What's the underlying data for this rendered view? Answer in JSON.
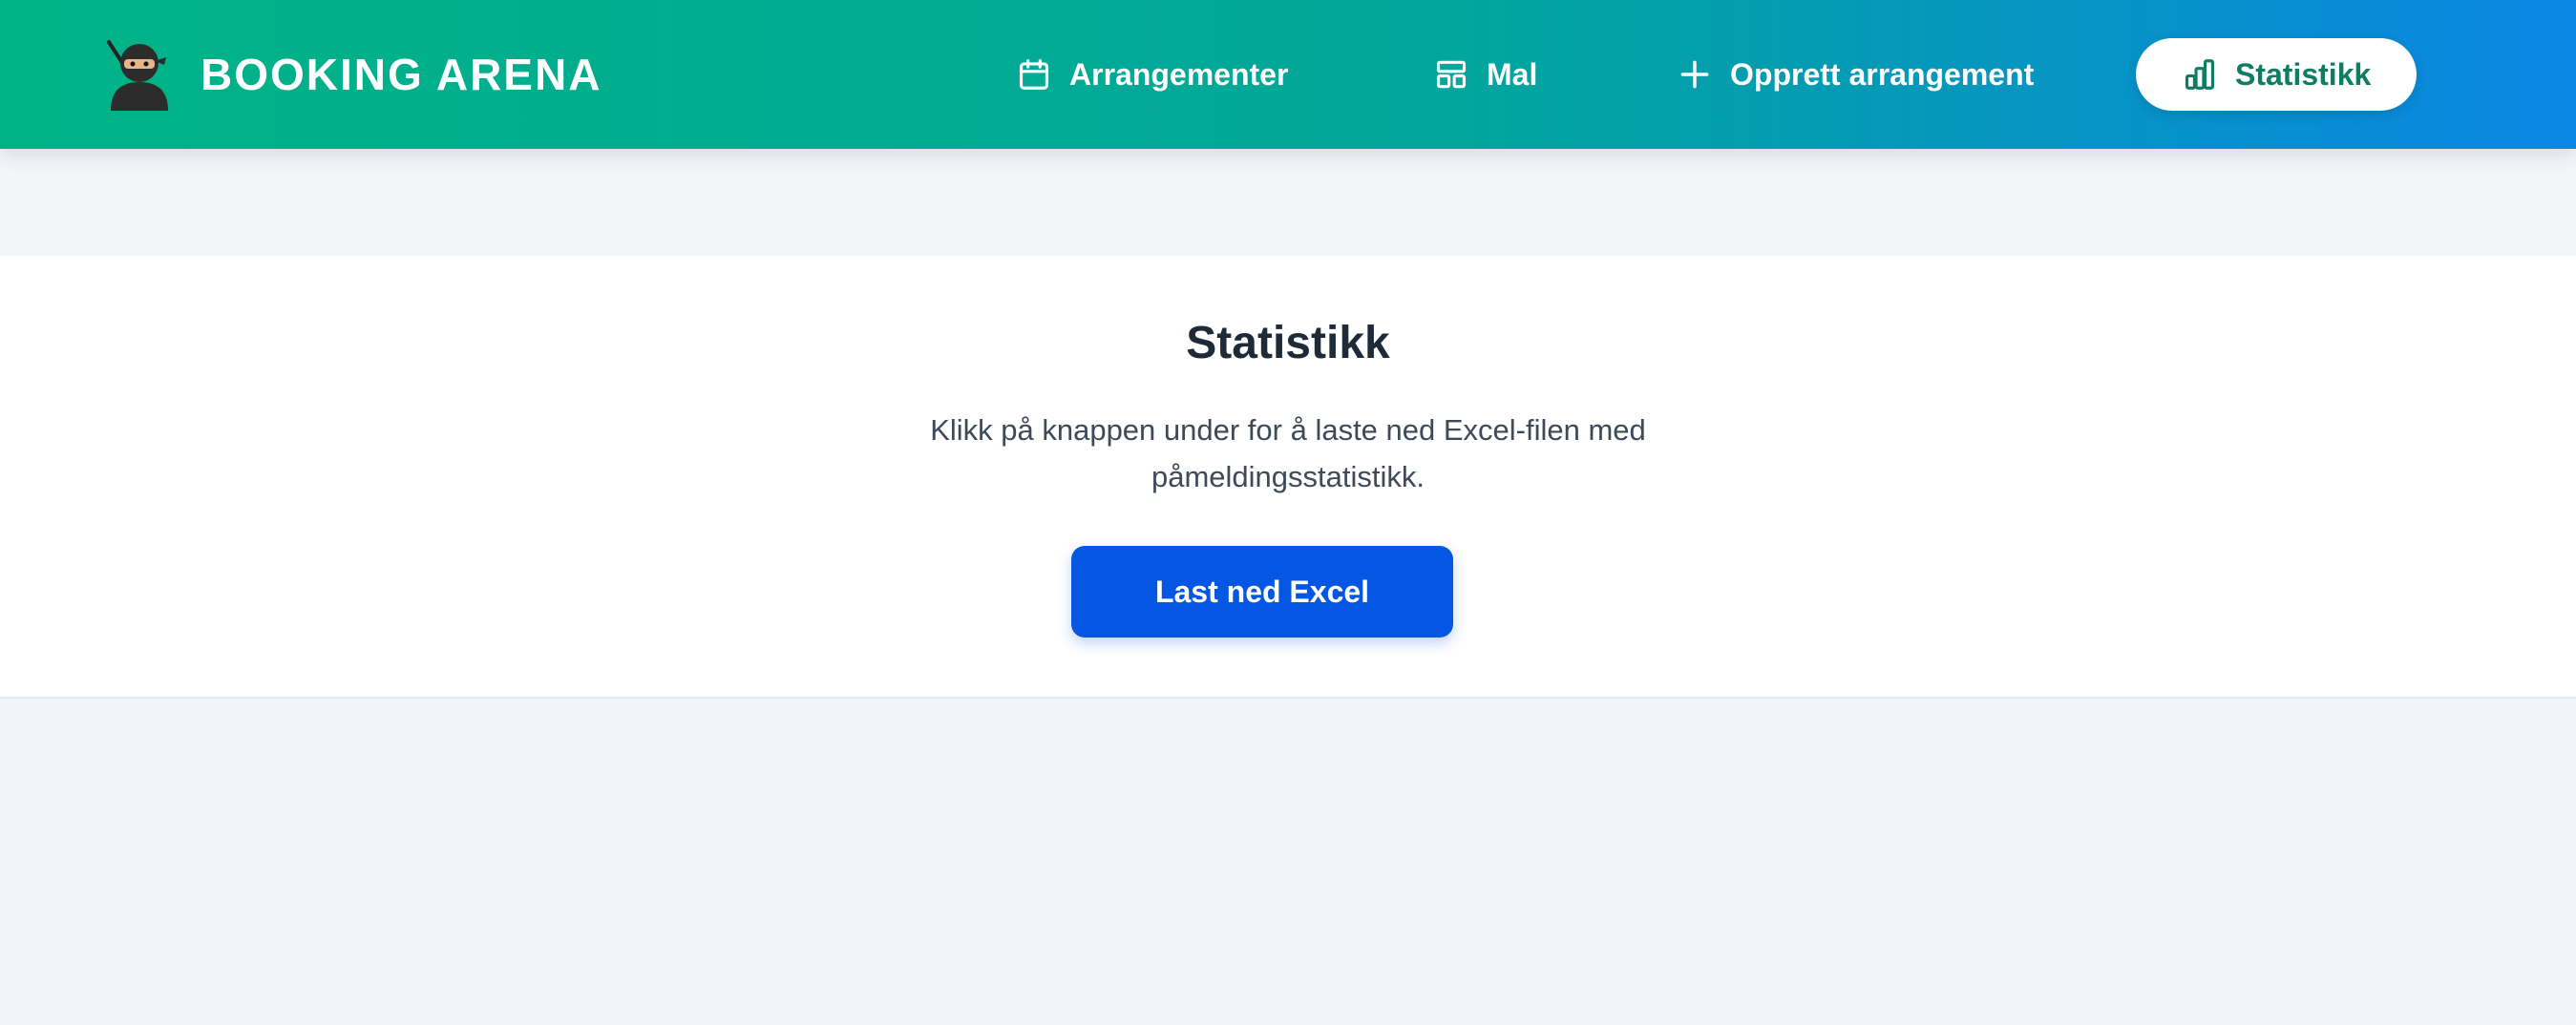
{
  "header": {
    "brand_title": "BOOKING ARENA",
    "logo_icon": "ninja-icon",
    "nav": {
      "events_label": "Arrangementer",
      "templates_label": "Mal",
      "create_label": "Opprett arrangement",
      "statistics_label": "Statistikk"
    },
    "active_item": "Statistikk",
    "gradient_colors": [
      "#00b386",
      "#0a86e4"
    ]
  },
  "main": {
    "title": "Statistikk",
    "description": "Klikk på knappen under for å laste ned Excel-filen med påmeldingsstatistikk.",
    "download_label": "Last ned Excel",
    "button_color": "#0556e3"
  }
}
